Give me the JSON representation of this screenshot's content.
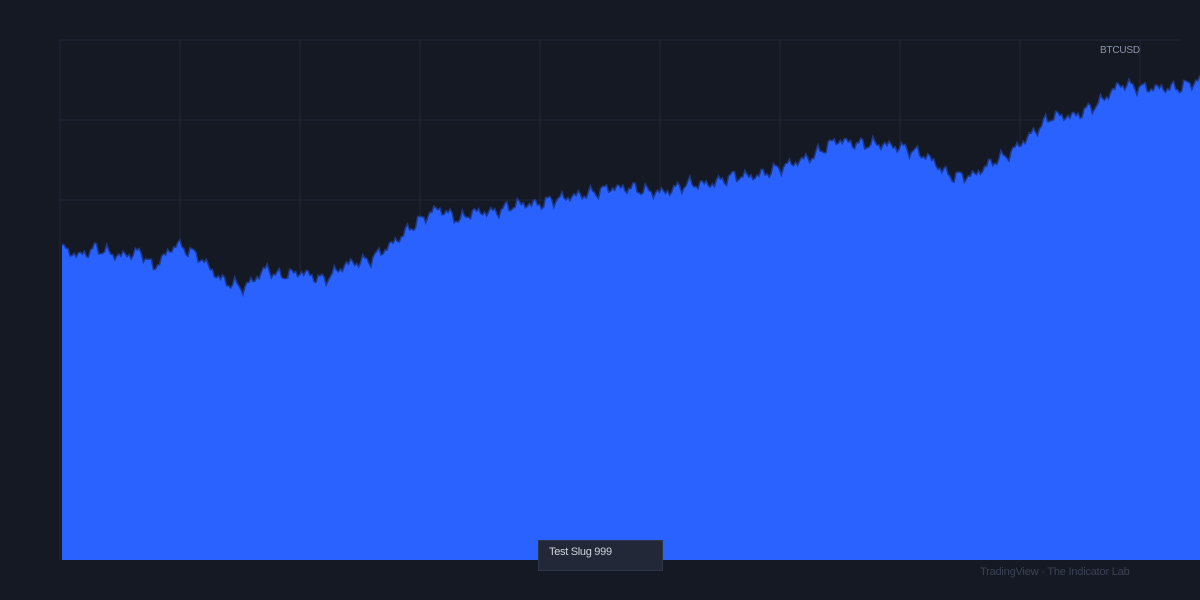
{
  "chart_data": {
    "type": "area",
    "symbol": "BTCUSD",
    "title": "",
    "xlabel": "",
    "ylabel": "",
    "grid": true,
    "colors": {
      "background": "#151924",
      "fill": "#2962ff",
      "line": "#1e3a8a",
      "grid": "#232838"
    },
    "ylim": [
      0,
      130
    ],
    "xlim": [
      0,
      100
    ],
    "x": [
      0,
      1.5,
      3,
      5,
      7,
      8,
      10,
      12,
      14,
      16,
      18,
      19,
      21,
      23,
      25,
      27,
      29,
      31,
      33,
      35,
      36,
      38,
      40,
      42,
      43,
      45,
      47,
      48,
      50,
      52,
      53,
      55,
      57,
      59,
      61,
      63,
      65,
      66,
      68,
      70,
      72,
      74,
      76,
      78,
      80,
      82,
      83,
      85,
      87,
      89,
      91,
      93,
      95,
      96,
      98,
      100
    ],
    "y": [
      78,
      76,
      78,
      76,
      77,
      73,
      79,
      76,
      70,
      68,
      73,
      71,
      72,
      70,
      74,
      75,
      79,
      84,
      88,
      85,
      87,
      87,
      89,
      89,
      90,
      91,
      92,
      93,
      93,
      92,
      92,
      94,
      94,
      96,
      96,
      98,
      100,
      101,
      105,
      104,
      104,
      103,
      101,
      96,
      96,
      100,
      101,
      106,
      111,
      111,
      114,
      119,
      118,
      118,
      118,
      120
    ]
  },
  "overlay": {
    "slug": "Test Slug 999",
    "credit": "TradingView · The Indicator Lab"
  }
}
